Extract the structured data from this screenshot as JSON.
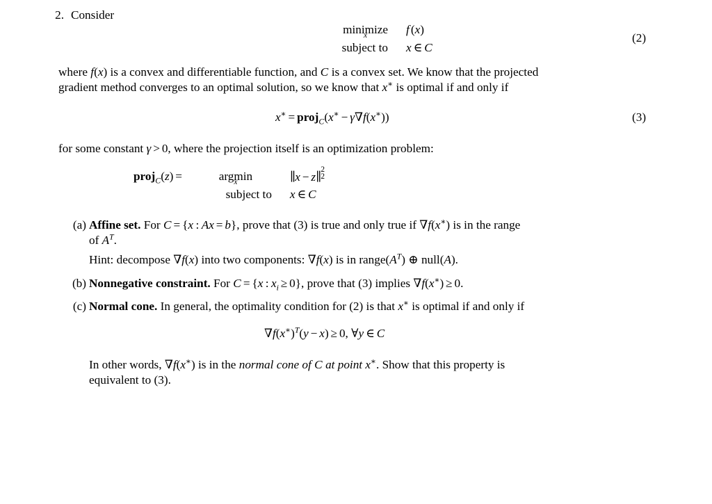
{
  "document": {
    "problem_number": "2.",
    "intro": "Consider",
    "equations": {
      "eq2": {
        "number": "(2)",
        "objective_keyword": "minimize",
        "objective_variable": "x",
        "objective_expression": "f(x)",
        "constraint_keyword": "subject to",
        "constraint_expression": "x ∈ C"
      },
      "eq3": {
        "number": "(3)",
        "expression": "x* = proj_C(x* − γ∇f(x*))"
      },
      "proj_def": {
        "lhs": "proj_C(z) =",
        "argmin_keyword": "argmin",
        "argmin_variable": "x",
        "objective_expression": "||x − z||²₂",
        "constraint_keyword": "subject to",
        "constraint_expression": "x ∈ C"
      },
      "normal_cone": {
        "expression": "∇f(x*)^T (y − x) ≥ 0, ∀y ∈ C"
      }
    },
    "paragraph_1": {
      "line1_a": "where ",
      "line1_b": "f(x)",
      "line1_c": " is a convex and differentiable function, and ",
      "line1_d": "C",
      "line1_e": " is a convex set. We know that the projected",
      "line2_a": "gradient method converges to an optimal solution, so we know that ",
      "line2_b": "x*",
      "line2_c": " is optimal if and only if"
    },
    "paragraph_2": {
      "a": "for some constant ",
      "b": "γ > 0",
      "c": ", where the projection itself is an optimization problem:"
    },
    "parts": [
      {
        "label": "(a)",
        "title": "Affine set.",
        "line1_a": "For ",
        "line1_b": "C = {x : Ax = b}",
        "line1_c": ", prove that (3) is true and only true if ",
        "line1_d": "∇f(x*)",
        "line1_e": " is in the range",
        "line2_a": "of ",
        "line2_b": "A^T",
        "line2_c": ".",
        "hint_a": "Hint: decompose ",
        "hint_b": "∇f(x)",
        "hint_c": " into two components: ",
        "hint_d": "∇f(x)",
        "hint_e": " is in range(",
        "hint_f": "A^T",
        "hint_g": ") ⊕ null(",
        "hint_h": "A",
        "hint_i": ")."
      },
      {
        "label": "(b)",
        "title": "Nonnegative constraint.",
        "line1_a": "For ",
        "line1_b": "C = {x : x_i ≥ 0}",
        "line1_c": ", prove that (3) implies ",
        "line1_d": "∇f(x*) ≥ 0",
        "line1_e": "."
      },
      {
        "label": "(c)",
        "title": "Normal cone.",
        "line1_a": "In general, the optimality condition for (2) is that ",
        "line1_b": "x*",
        "line1_c": " is optimal if and only if",
        "closing_line1_a": "In other words, ",
        "closing_line1_b": "∇f(x*)",
        "closing_line1_c": " is in the ",
        "closing_line1_d": "normal cone of C at point x*",
        "closing_line1_e": ". Show that this property is",
        "closing_line2": "equivalent to (3)."
      }
    ]
  }
}
